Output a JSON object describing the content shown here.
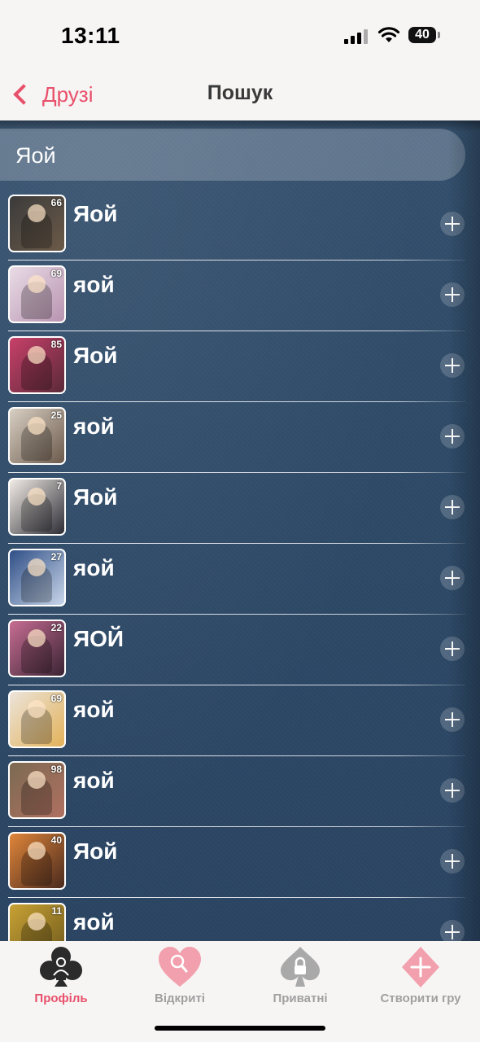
{
  "status_bar": {
    "time": "13:11",
    "battery": "40"
  },
  "nav": {
    "back_label": "Друзі",
    "title": "Пошук"
  },
  "search": {
    "value": "Яой"
  },
  "results": [
    {
      "name": "Яой",
      "level": "66",
      "colors": [
        "#3b3b3b",
        "#6b5a48"
      ]
    },
    {
      "name": "яой",
      "level": "69",
      "colors": [
        "#e9dce6",
        "#b893b0"
      ]
    },
    {
      "name": "Яой",
      "level": "85",
      "colors": [
        "#c8406a",
        "#5b2a3a"
      ]
    },
    {
      "name": "яой",
      "level": "25",
      "colors": [
        "#d8cfc3",
        "#6c5a4c"
      ]
    },
    {
      "name": "Яой",
      "level": "7",
      "colors": [
        "#f2ece6",
        "#2d2d36"
      ]
    },
    {
      "name": "яой",
      "level": "27",
      "colors": [
        "#2f4f86",
        "#c9d6ea"
      ]
    },
    {
      "name": "ЯОЙ",
      "level": "22",
      "colors": [
        "#c76d93",
        "#3a2433"
      ]
    },
    {
      "name": "яой",
      "level": "69",
      "colors": [
        "#ece4da",
        "#e2b25a"
      ]
    },
    {
      "name": "яой",
      "level": "98",
      "colors": [
        "#7b6a52",
        "#b07060"
      ]
    },
    {
      "name": "Яой",
      "level": "40",
      "colors": [
        "#e0863a",
        "#4a2a1e"
      ]
    },
    {
      "name": "яой",
      "level": "11",
      "colors": [
        "#c9a235",
        "#6e5a1c"
      ]
    }
  ],
  "tabs": [
    {
      "label": "Профіль",
      "icon": "club-profile-icon",
      "active": true
    },
    {
      "label": "Відкриті",
      "icon": "heart-search-icon",
      "active": false
    },
    {
      "label": "Приватні",
      "icon": "spade-lock-icon",
      "active": false
    },
    {
      "label": "Створити гру",
      "icon": "diamond-plus-icon",
      "active": false
    }
  ],
  "colors": {
    "accent": "#e8506a",
    "background": "#2e4a68",
    "tab_inactive": "#a0a0a0"
  }
}
